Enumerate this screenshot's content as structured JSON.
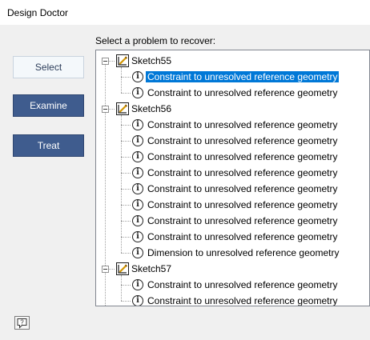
{
  "window": {
    "title": "Design Doctor"
  },
  "prompt": "Select a problem to recover:",
  "steps": {
    "select": "Select",
    "examine": "Examine",
    "treat": "Treat"
  },
  "tree": {
    "icons": {
      "group": "sketch-icon",
      "item": "info-icon",
      "item_glyph": "i"
    },
    "groups": [
      {
        "label": "Sketch55",
        "items": [
          {
            "label": "Constraint to unresolved reference geometry",
            "selected": true
          },
          {
            "label": "Constraint to unresolved reference geometry"
          }
        ]
      },
      {
        "label": "Sketch56",
        "items": [
          {
            "label": "Constraint to unresolved reference geometry"
          },
          {
            "label": "Constraint to unresolved reference geometry"
          },
          {
            "label": "Constraint to unresolved reference geometry"
          },
          {
            "label": "Constraint to unresolved reference geometry"
          },
          {
            "label": "Constraint to unresolved reference geometry"
          },
          {
            "label": "Constraint to unresolved reference geometry"
          },
          {
            "label": "Constraint to unresolved reference geometry"
          },
          {
            "label": "Constraint to unresolved reference geometry"
          },
          {
            "label": "Dimension to unresolved reference geometry"
          }
        ]
      },
      {
        "label": "Sketch57",
        "items": [
          {
            "label": "Constraint to unresolved reference geometry"
          },
          {
            "label": "Constraint to unresolved reference geometry"
          }
        ]
      }
    ]
  },
  "colors": {
    "accent": "#3f5c8e",
    "selection": "#0078d7"
  },
  "help": {
    "icon": "help-icon"
  }
}
